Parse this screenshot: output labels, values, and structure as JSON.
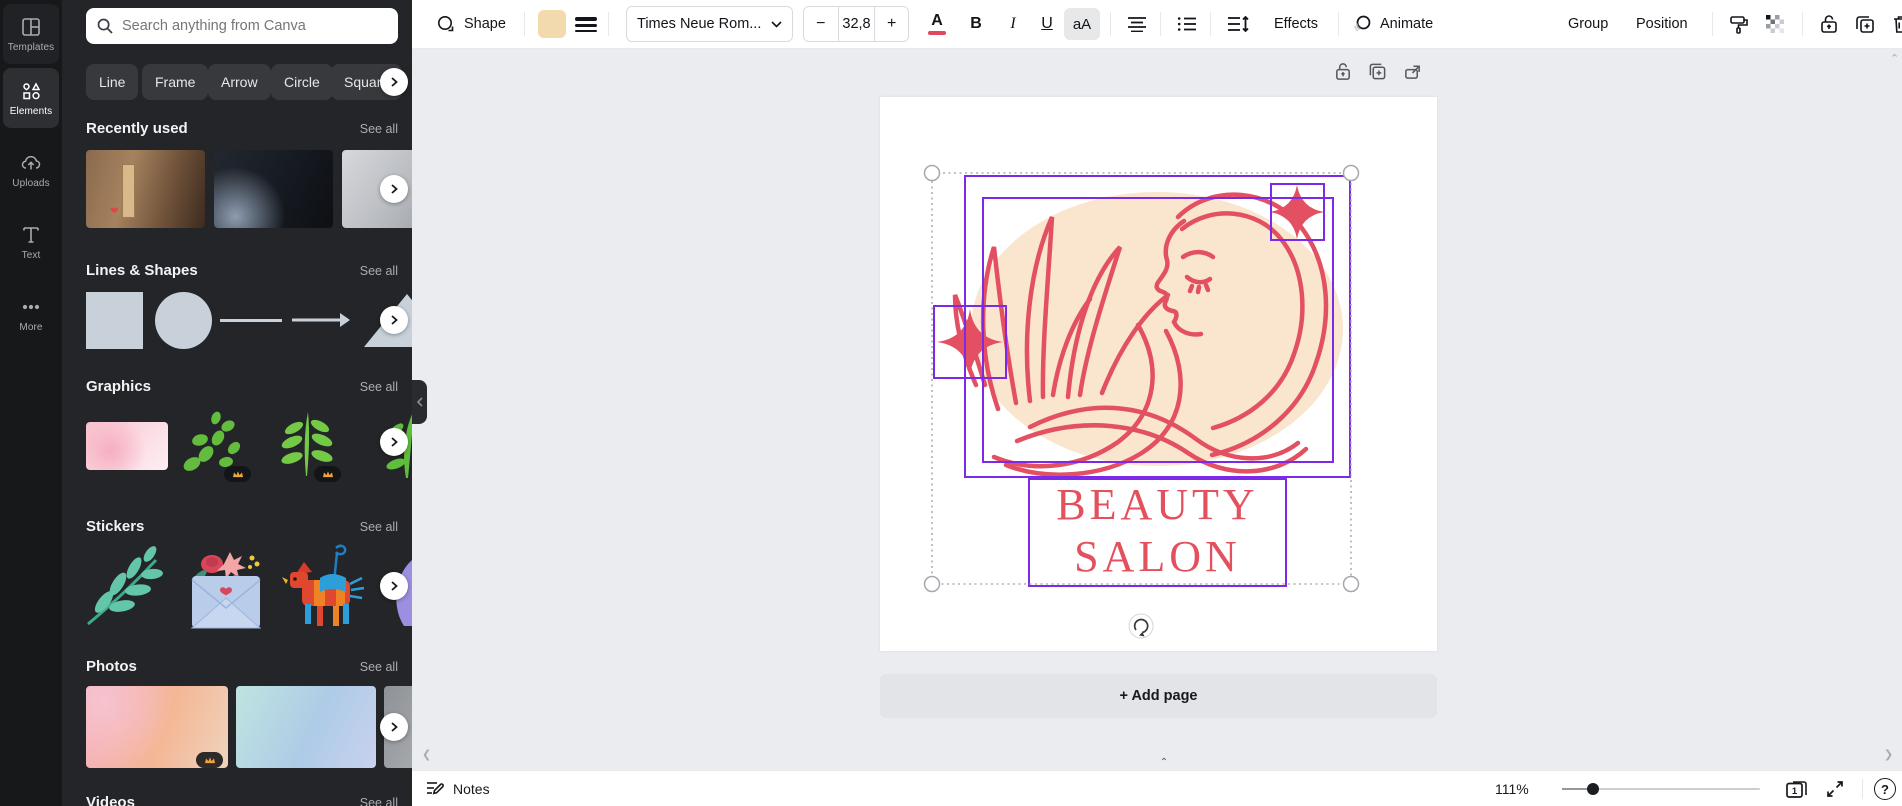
{
  "rail": {
    "items": [
      {
        "label": "Templates"
      },
      {
        "label": "Elements"
      },
      {
        "label": "Uploads"
      },
      {
        "label": "Text"
      },
      {
        "label": "More"
      }
    ]
  },
  "panel": {
    "search_placeholder": "Search anything from Canva",
    "chips": [
      "Line",
      "Frame",
      "Arrow",
      "Circle",
      "Square"
    ],
    "sections": {
      "recently": {
        "title": "Recently used",
        "see_all": "See all"
      },
      "shapes": {
        "title": "Lines & Shapes",
        "see_all": "See all"
      },
      "graphics": {
        "title": "Graphics",
        "see_all": "See all"
      },
      "stickers": {
        "title": "Stickers",
        "see_all": "See all"
      },
      "photos": {
        "title": "Photos",
        "see_all": "See all"
      },
      "videos": {
        "title": "Videos",
        "see_all": "See all"
      }
    }
  },
  "toolbar": {
    "shape_label": "Shape",
    "font_name": "Times Neue Rom...",
    "font_size_minus": "−",
    "font_size": "32,8",
    "font_size_plus": "+",
    "text_color_letter": "A",
    "bold": "B",
    "italic": "I",
    "underline": "U",
    "case_toggle": "aA",
    "effects_label": "Effects",
    "animate_label": "Animate",
    "group_label": "Group",
    "position_label": "Position"
  },
  "canvas": {
    "logo_line1": "BEAUTY",
    "logo_line2": "SALON",
    "add_page_label": "+ Add page"
  },
  "statusbar": {
    "notes_label": "Notes",
    "zoom_level": "111%",
    "page_number": "1",
    "help_label": "?"
  },
  "colors": {
    "brand_purple": "#7D2AE8",
    "logo_red": "#E25062",
    "logo_cream": "#FAE5CE",
    "shape_fill_swatch": "#F3D9AE",
    "text_color_indicator": "#E0485C"
  }
}
